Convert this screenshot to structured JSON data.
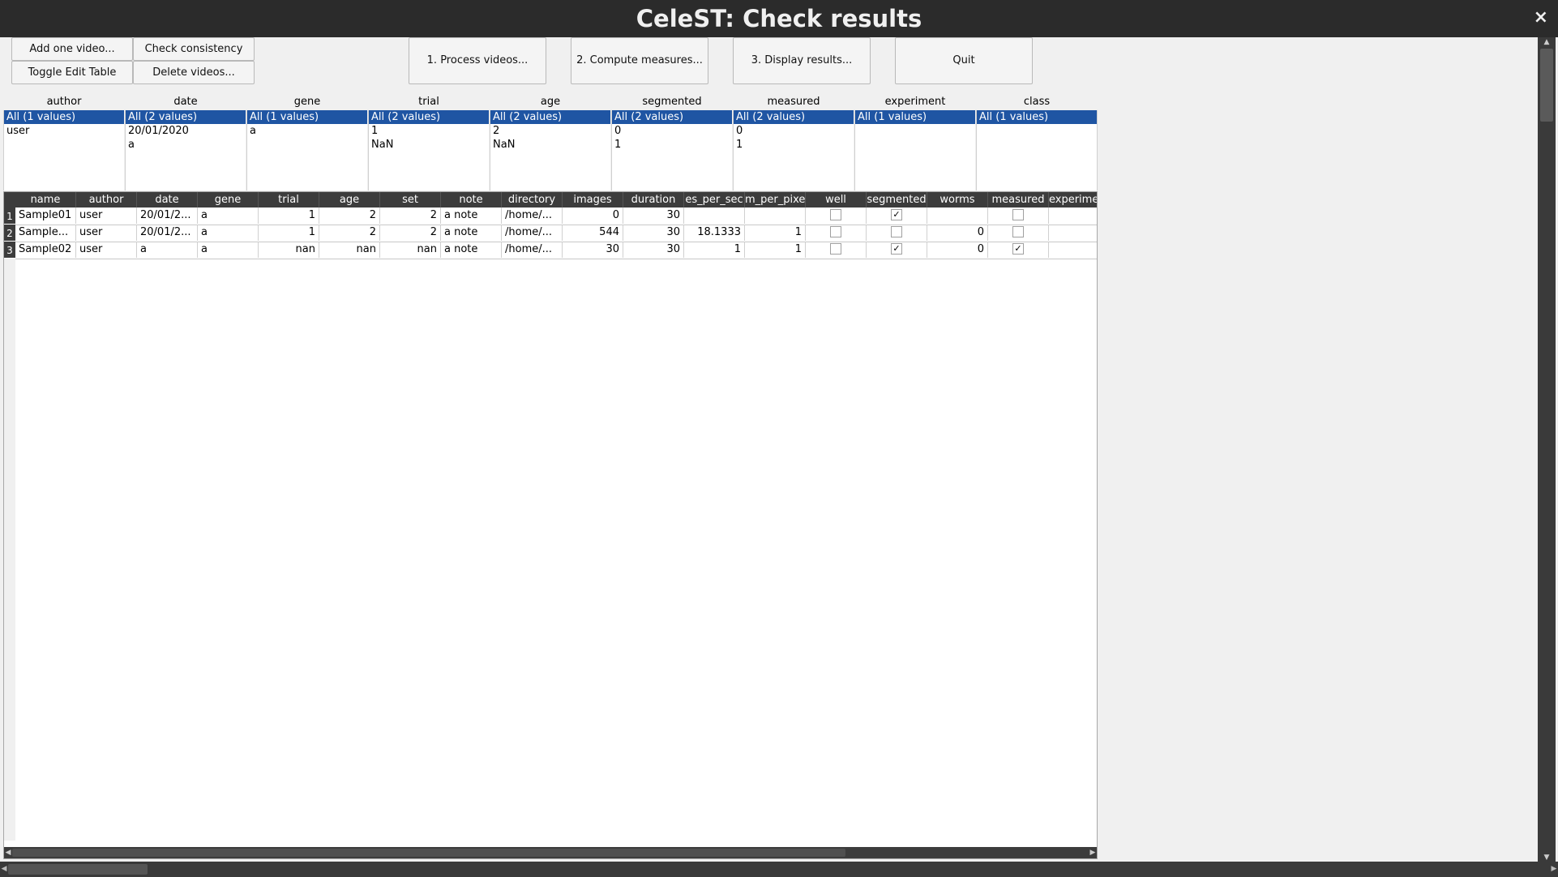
{
  "window": {
    "title": "CeleST: Check results",
    "close_glyph": "×"
  },
  "toolbar": {
    "add_one_video": "Add one video...",
    "check_consistency": "Check consistency",
    "toggle_edit_table": "Toggle Edit Table",
    "delete_videos": "Delete videos...",
    "process_videos": "1. Process videos...",
    "compute_measures": "2. Compute measures...",
    "display_results": "3. Display results...",
    "quit": "Quit"
  },
  "filters": [
    {
      "label": "author",
      "selected": "All (1 values)",
      "options": [
        "user"
      ]
    },
    {
      "label": "date",
      "selected": "All (2 values)",
      "options": [
        "20/01/2020",
        "a"
      ]
    },
    {
      "label": "gene",
      "selected": "All (1 values)",
      "options": [
        "a"
      ]
    },
    {
      "label": "trial",
      "selected": "All (2 values)",
      "options": [
        "1",
        "NaN"
      ]
    },
    {
      "label": "age",
      "selected": "All (2 values)",
      "options": [
        "2",
        "NaN"
      ]
    },
    {
      "label": "segmented",
      "selected": "All (2 values)",
      "options": [
        "0",
        "1"
      ]
    },
    {
      "label": "measured",
      "selected": "All (2 values)",
      "options": [
        "0",
        "1"
      ]
    },
    {
      "label": "experiment",
      "selected": "All (1 values)",
      "options": []
    },
    {
      "label": "class",
      "selected": "All (1 values)",
      "options": []
    }
  ],
  "table": {
    "headers": [
      "name",
      "author",
      "date",
      "gene",
      "trial",
      "age",
      "set",
      "note",
      "directory",
      "images",
      "duration",
      "es_per_sec",
      "m_per_pixe",
      "well",
      "segmented",
      "worms",
      "measured",
      "experime"
    ],
    "rows": [
      {
        "num": "1",
        "name": "Sample01",
        "author": "user",
        "date": "20/01/2...",
        "gene": "a",
        "trial": "1",
        "age": "2",
        "set": "2",
        "note": "a note",
        "directory": "/home/...",
        "images": "0",
        "duration": "30",
        "fps": "",
        "mpp": "",
        "well": false,
        "segmented": true,
        "worms": "",
        "measured": false,
        "experiment": ""
      },
      {
        "num": "2",
        "name": "Sample...",
        "author": "user",
        "date": "20/01/2...",
        "gene": "a",
        "trial": "1",
        "age": "2",
        "set": "2",
        "note": "a note",
        "directory": "/home/...",
        "images": "544",
        "duration": "30",
        "fps": "18.1333",
        "mpp": "1",
        "well": false,
        "segmented": false,
        "worms": "0",
        "measured": false,
        "experiment": ""
      },
      {
        "num": "3",
        "name": "Sample02",
        "author": "user",
        "date": "a",
        "gene": "a",
        "trial": "nan",
        "age": "nan",
        "set": "nan",
        "note": "a note",
        "directory": "/home/...",
        "images": "30",
        "duration": "30",
        "fps": "1",
        "mpp": "1",
        "well": false,
        "segmented": true,
        "worms": "0",
        "measured": true,
        "experiment": ""
      }
    ]
  },
  "colors": {
    "selection": "#1f55a3",
    "header": "#3c3c3c",
    "titlebar": "#2b2b2b"
  }
}
